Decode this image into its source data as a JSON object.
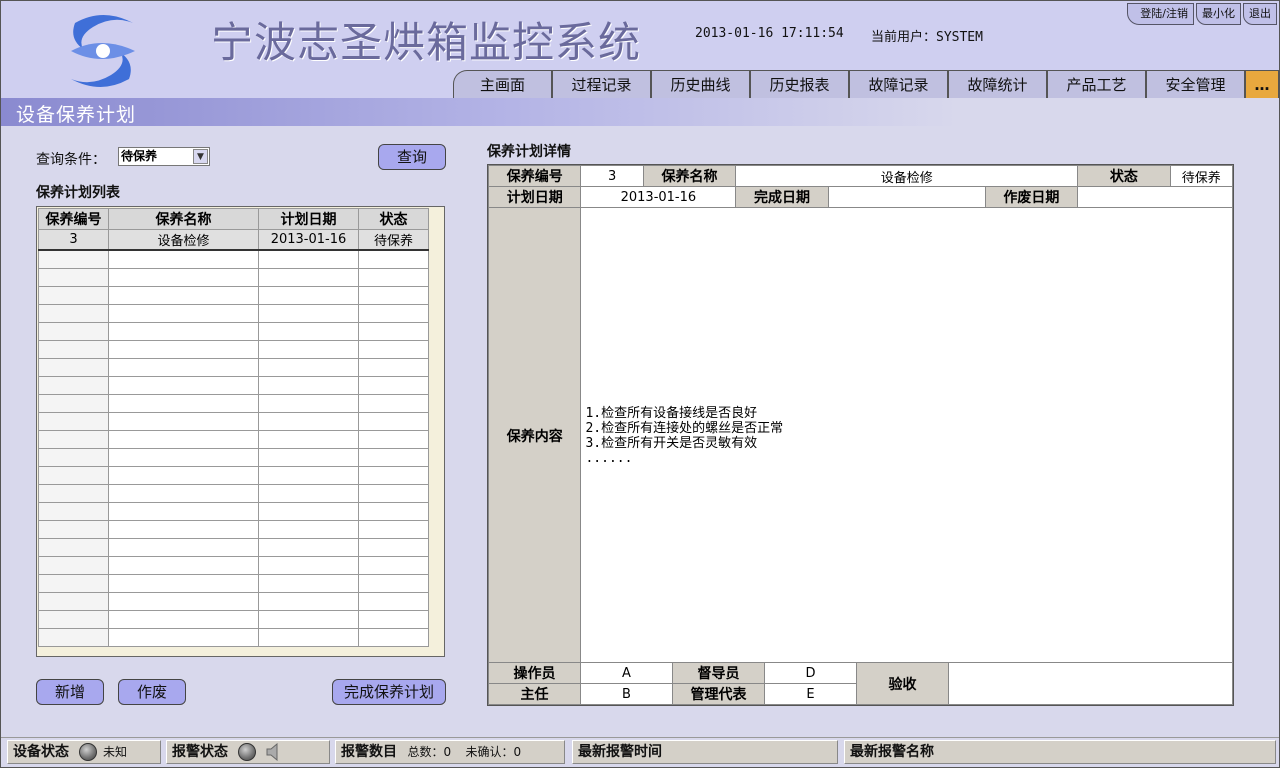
{
  "app": {
    "title": "宁波志圣烘箱监控系统",
    "datetime": "2013-01-16 17:11:54",
    "current_user": "当前用户：SYSTEM",
    "page_title": "设备保养计划"
  },
  "top_buttons": [
    "登陆/注销",
    "最小化",
    "退出"
  ],
  "nav_tabs": [
    "主画面",
    "过程记录",
    "历史曲线",
    "历史报表",
    "故障记录",
    "故障统计",
    "产品工艺",
    "安全管理",
    "…"
  ],
  "query": {
    "label": "查询条件：",
    "selected": "待保养",
    "button": "查询"
  },
  "list": {
    "title": "保养计划列表",
    "columns": [
      "保养编号",
      "保养名称",
      "计划日期",
      "状态"
    ],
    "rows": [
      [
        "3",
        "设备检修",
        "2013-01-16",
        "待保养"
      ]
    ]
  },
  "left_buttons": {
    "add": "新增",
    "void": "作废",
    "complete": "完成保养计划"
  },
  "detail": {
    "title": "保养计划详情",
    "id_label": "保养编号",
    "id": "3",
    "name_label": "保养名称",
    "name": "设备检修",
    "status_label": "状态",
    "status": "待保养",
    "plan_date_label": "计划日期",
    "plan_date": "2013-01-16",
    "done_date_label": "完成日期",
    "done_date": "",
    "void_date_label": "作废日期",
    "void_date": "",
    "content_label": "保养内容",
    "content": "1.检查所有设备接线是否良好\n2.检查所有连接处的螺丝是否正常\n3.检查所有开关是否灵敏有效\n......",
    "operator_label": "操作员",
    "operator": "A",
    "supervisor_label": "督导员",
    "supervisor": "D",
    "director_label": "主任",
    "director": "B",
    "manager_label": "管理代表",
    "manager": "E",
    "accept_label": "验收",
    "accept": ""
  },
  "status_bar": {
    "device_label": "设备状态",
    "device_value": "未知",
    "alarm_label": "报警状态",
    "count_label": "报警数目",
    "total": "总数：0",
    "unconfirmed": "未确认：0",
    "latest_time_label": "最新报警时间",
    "latest_name_label": "最新报警名称"
  }
}
